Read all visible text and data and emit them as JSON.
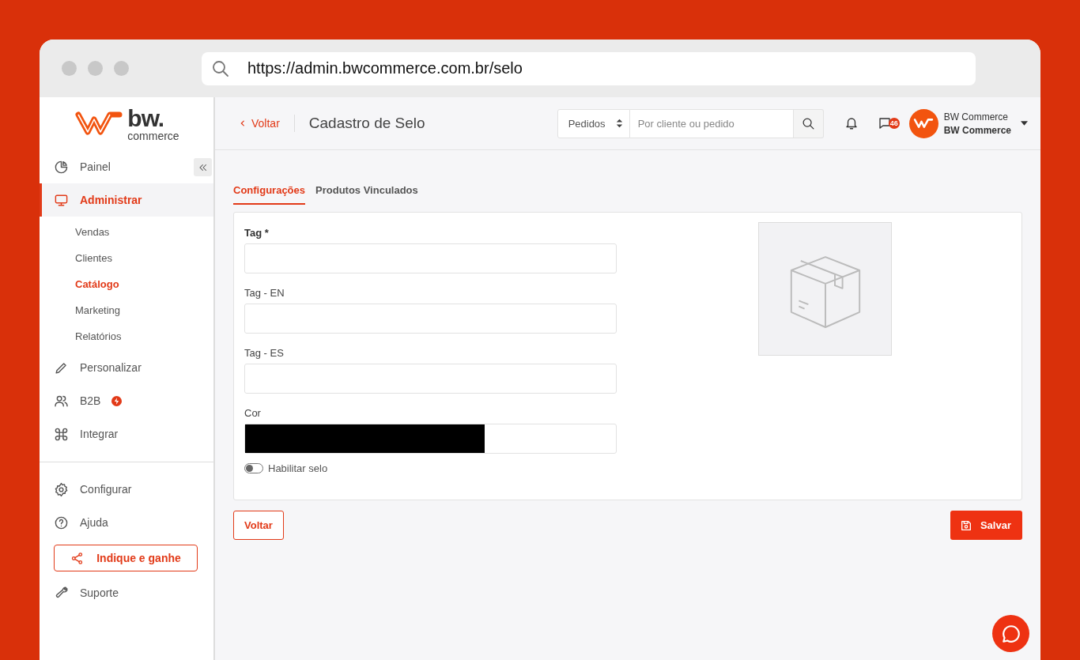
{
  "browser": {
    "url": "https://admin.bwcommerce.com.br/selo"
  },
  "sidebar": {
    "logo": {
      "wordmark": "bw.",
      "tagline": "commerce"
    },
    "main_items": [
      {
        "label": "Painel",
        "selected": false
      },
      {
        "label": "Administrar",
        "selected": true,
        "children": [
          {
            "label": "Vendas",
            "selected": false
          },
          {
            "label": "Clientes",
            "selected": false
          },
          {
            "label": "Catálogo",
            "selected": true
          },
          {
            "label": "Marketing",
            "selected": false
          },
          {
            "label": "Relatórios",
            "selected": false
          }
        ]
      },
      {
        "label": "Personalizar",
        "selected": false
      },
      {
        "label": "B2B",
        "selected": false,
        "badge": true
      },
      {
        "label": "Integrar",
        "selected": false
      }
    ],
    "bottom_items": [
      {
        "label": "Configurar",
        "selected": false
      },
      {
        "label": "Ajuda",
        "selected": false
      }
    ],
    "referral_button": "Indique e ganhe",
    "support_item": {
      "label": "Suporte",
      "selected": false
    }
  },
  "header": {
    "back_link": "Voltar",
    "title": "Cadastro de Selo",
    "search_scope": "Pedidos",
    "search_placeholder": "Por cliente ou pedido",
    "messages_count": "46",
    "user_name": "BW Commerce",
    "store_name": "BW Commerce"
  },
  "tabs": [
    {
      "label": "Configurações",
      "selected": true
    },
    {
      "label": "Produtos Vinculados",
      "selected": false
    }
  ],
  "form": {
    "fields": [
      {
        "kind": "text",
        "label": "Tag *",
        "required": true
      },
      {
        "kind": "text",
        "label": "Tag - EN",
        "required": false
      },
      {
        "kind": "text",
        "label": "Tag - ES",
        "required": false
      },
      {
        "kind": "color",
        "label": "Cor",
        "required": false,
        "color": "#000000"
      }
    ],
    "toggle": {
      "label": "Habilitar selo",
      "on": false
    }
  },
  "actions": {
    "back_button": "Voltar",
    "save_button": "Salvar"
  }
}
